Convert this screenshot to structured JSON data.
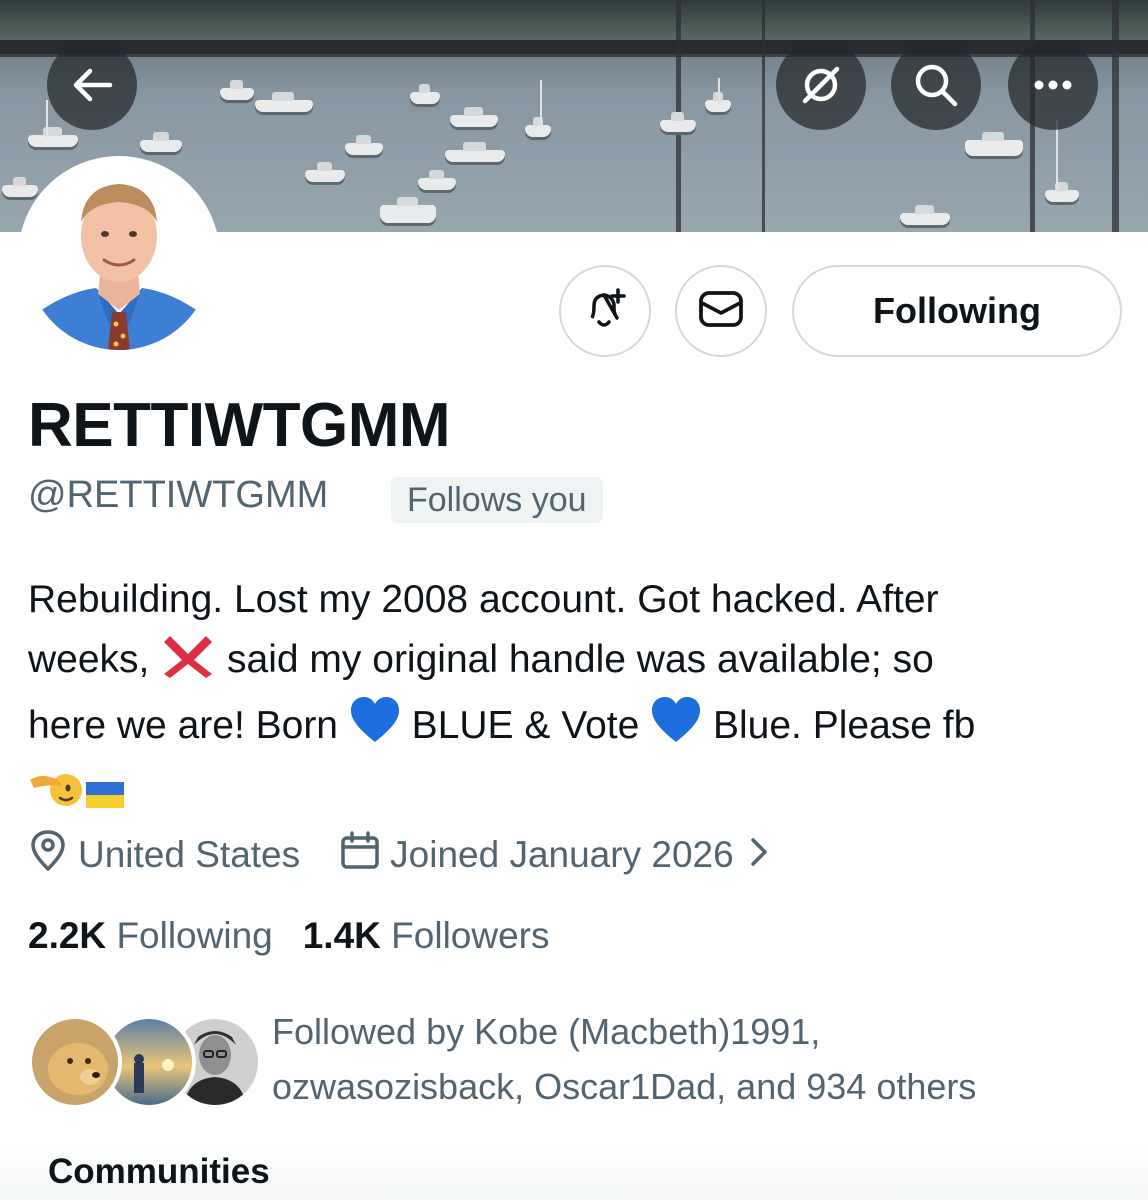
{
  "header": {
    "back_icon": "arrow-left-icon",
    "grok_icon": "grok-icon",
    "search_icon": "search-icon",
    "more_icon": "more-horizontal-icon"
  },
  "profile": {
    "display_name": "RETTIWTGMM",
    "handle": "@RETTIWTGMM",
    "follows_you": "Follows you",
    "bio": {
      "line1": "Rebuilding. Lost my 2008 account. Got hacked. After",
      "line2a": "weeks, ",
      "line2b": " said my original handle was available; so",
      "line3a": "here we are! Born ",
      "line3b": " BLUE & Vote ",
      "line3c": " Blue. Please fb"
    },
    "location": "United States",
    "joined": "Joined January 2026",
    "following_count": "2.2K",
    "following_label": "Following",
    "followers_count": "1.4K",
    "followers_label": "Followers"
  },
  "actions": {
    "notify_icon": "bell-plus-icon",
    "message_icon": "envelope-icon",
    "follow_state": "Following"
  },
  "followed_by": {
    "line1": "Followed by Kobe (Macbeth)1991,",
    "line2": "ozwasozisback, Oscar1Dad, and 934 others"
  },
  "sections": {
    "communities": "Communities"
  },
  "colors": {
    "primary_text": "#0f1419",
    "secondary_text": "#536471",
    "border": "#cfd9de",
    "heart_blue": "#1d6fe0",
    "cross_red": "#dd2e44"
  }
}
